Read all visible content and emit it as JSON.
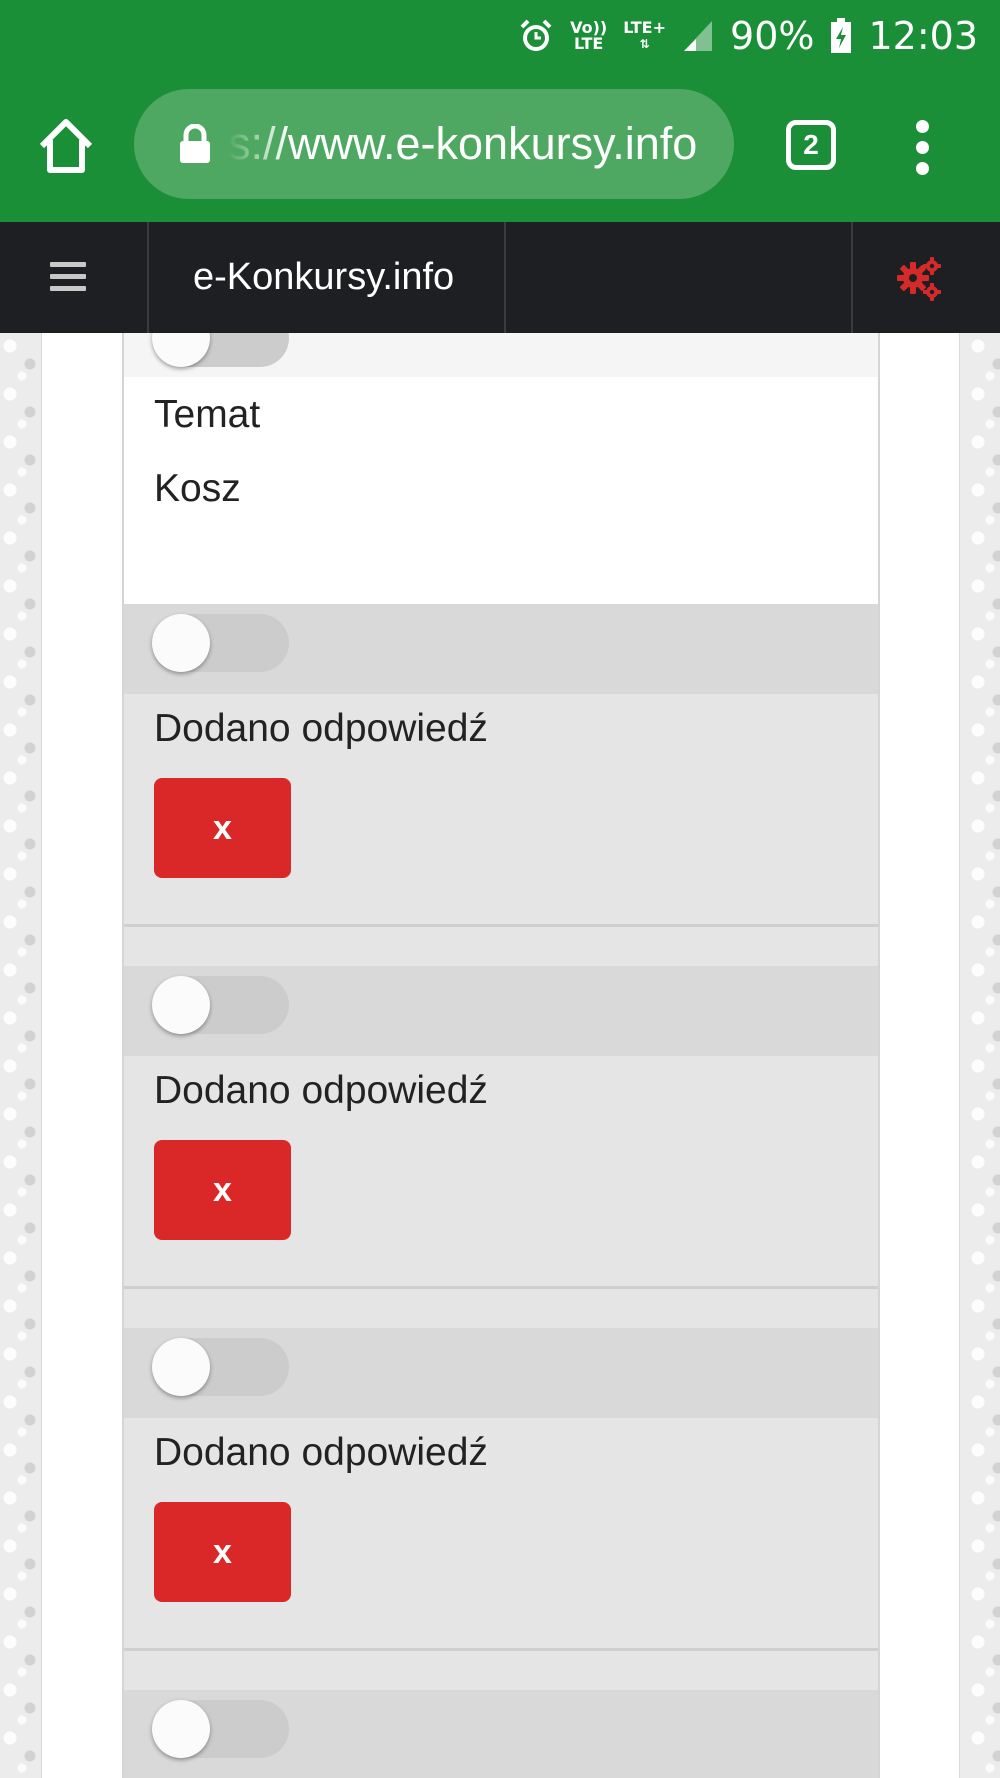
{
  "status_bar": {
    "alarm_icon": "alarm-icon",
    "volte_label": "Vo))\nLTE",
    "lte_label": "LTE+",
    "battery_percent": "90%",
    "time": "12:03"
  },
  "browser": {
    "url": "s://www.e-konkursy.info",
    "tab_count": "2"
  },
  "site_nav": {
    "brand": "e-Konkursy.info"
  },
  "top_card": {
    "items": [
      "Temat",
      "Kosz"
    ]
  },
  "cards": [
    {
      "label": "Dodano odpowiedź",
      "delete_label": "x",
      "toggle_on": false
    },
    {
      "label": "Dodano odpowiedź",
      "delete_label": "x",
      "toggle_on": false
    },
    {
      "label": "Dodano odpowiedź",
      "delete_label": "x",
      "toggle_on": false
    }
  ],
  "colors": {
    "browser_green": "#1b8f37",
    "nav_dark": "#1e1f22",
    "delete_red": "#da2828",
    "settings_red": "#d42a2a"
  }
}
